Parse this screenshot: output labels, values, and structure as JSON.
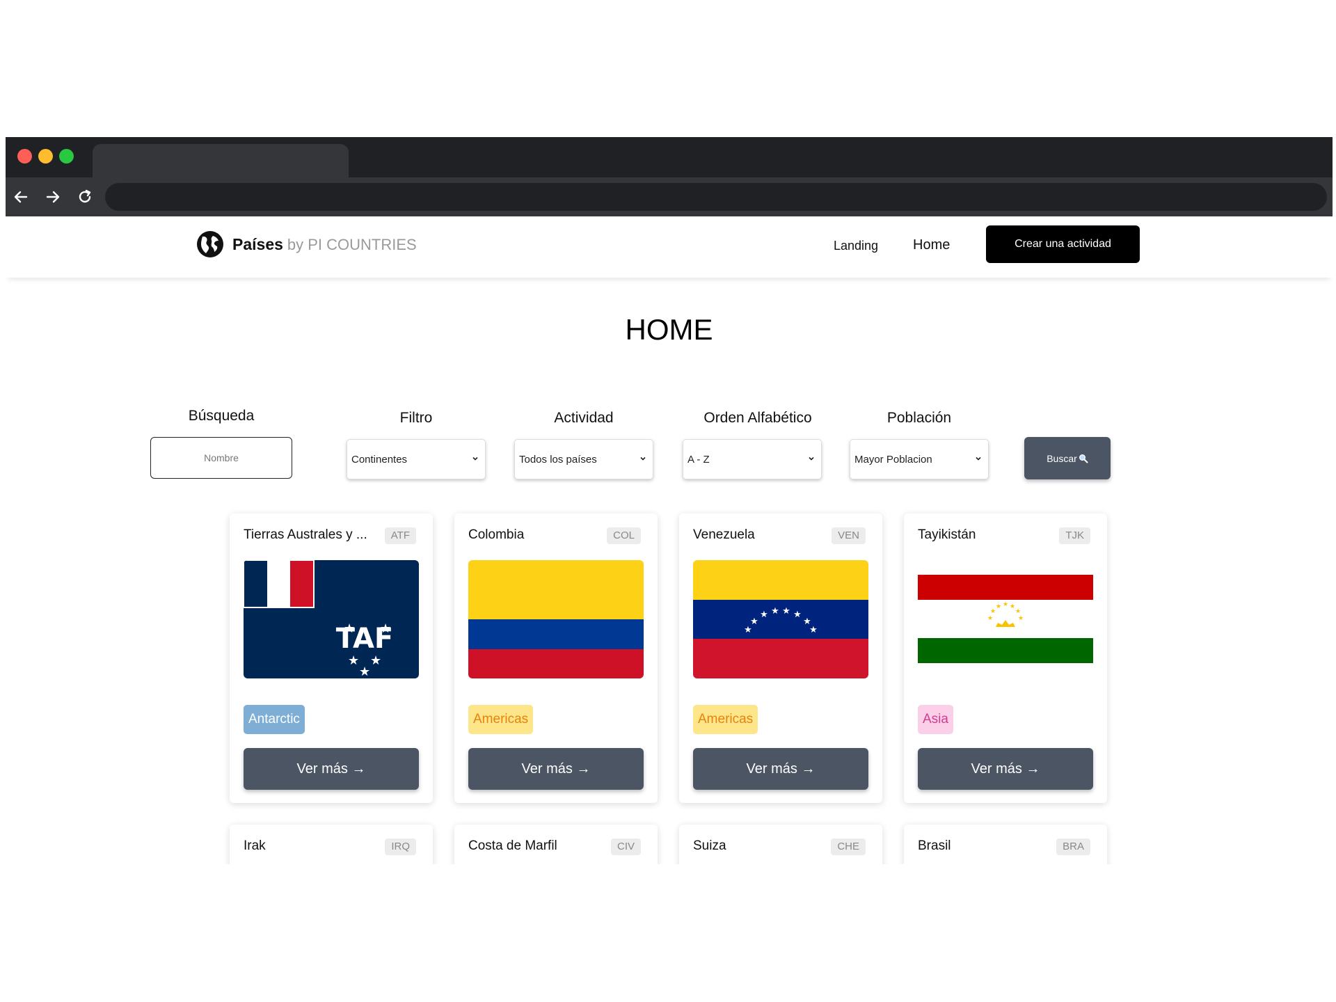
{
  "header": {
    "brand": "Países",
    "brand_sub": "by PI COUNTRIES",
    "nav": {
      "landing": "Landing",
      "home": "Home"
    },
    "cta_label": "Crear una actividad"
  },
  "page": {
    "title": "HOME"
  },
  "filters": {
    "search": {
      "label": "Búsqueda",
      "placeholder": "Nombre"
    },
    "continent": {
      "label": "Filtro",
      "selected": "Continentes"
    },
    "activity": {
      "label": "Actividad",
      "selected": "Todos los países"
    },
    "alpha": {
      "label": "Orden Alfabético",
      "selected": "A - Z"
    },
    "population": {
      "label": "Población",
      "selected": "Mayor Poblacion"
    },
    "search_button": "Buscar"
  },
  "cards": [
    {
      "name": "Tierras Australes y ...",
      "code": "ATF",
      "continent": "Antarctic",
      "button": "Ver más →"
    },
    {
      "name": "Colombia",
      "code": "COL",
      "continent": "Americas",
      "button": "Ver más →"
    },
    {
      "name": "Venezuela",
      "code": "VEN",
      "continent": "Americas",
      "button": "Ver más →"
    },
    {
      "name": "Tayikistán",
      "code": "TJK",
      "continent": "Asia",
      "button": "Ver más →"
    },
    {
      "name": "Irak",
      "code": "IRQ"
    },
    {
      "name": "Costa de Marfil",
      "code": "CIV"
    },
    {
      "name": "Suiza",
      "code": "CHE"
    },
    {
      "name": "Brasil",
      "code": "BRA"
    }
  ],
  "icons": {
    "logo": "globe-icon",
    "back": "arrow-left-icon",
    "forward": "arrow-right-icon",
    "reload": "reload-icon",
    "search": "magnifier-icon",
    "select": "chevron-down-icon"
  },
  "colors": {
    "button_bg": "#4b5563",
    "cta_bg": "#000000",
    "antarctic": "#7eaed6",
    "americas_bg": "#fde68a",
    "americas_text": "#e8820c",
    "asia_bg": "#fbcfe8",
    "asia_text": "#d33b8f"
  }
}
